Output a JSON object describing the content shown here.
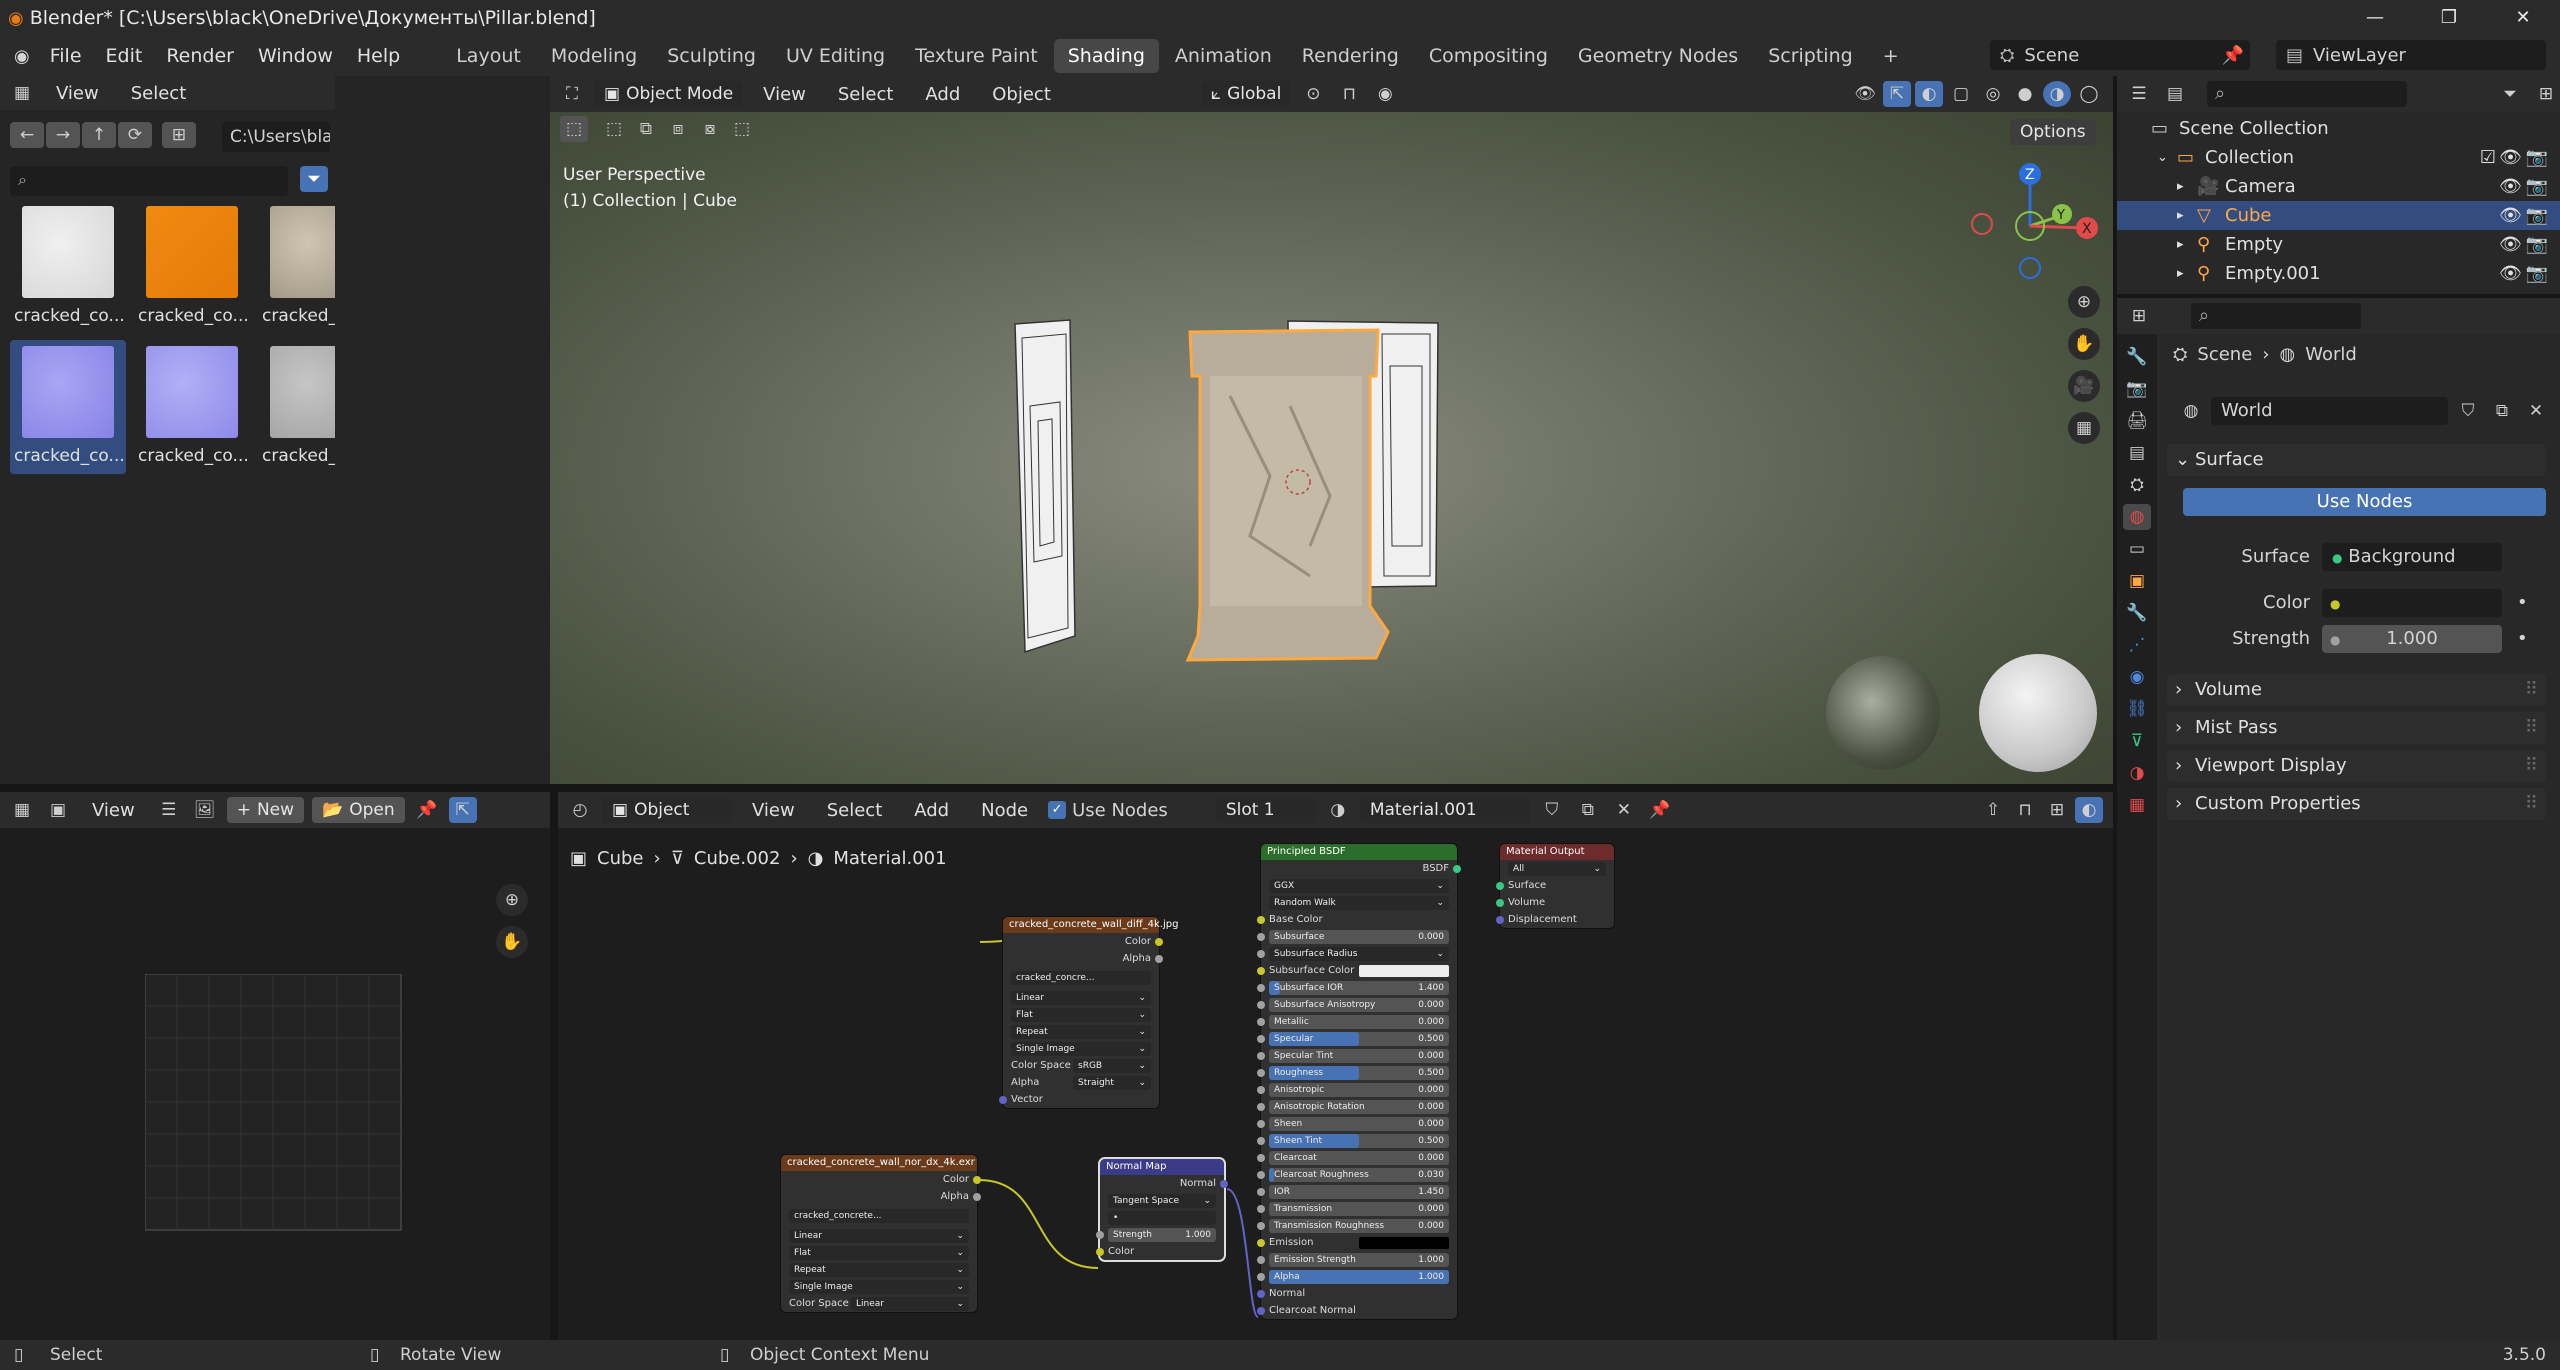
{
  "window": {
    "title": "Blender* [C:\\Users\\black\\OneDrive\\Документы\\Pillar.blend]"
  },
  "menu": [
    "File",
    "Edit",
    "Render",
    "Window",
    "Help"
  ],
  "workspaces": [
    "Layout",
    "Modeling",
    "Sculpting",
    "UV Editing",
    "Texture Paint",
    "Shading",
    "Animation",
    "Rendering",
    "Compositing",
    "Geometry Nodes",
    "Scripting"
  ],
  "active_workspace": "Shading",
  "scene": {
    "label": "Scene",
    "viewlayer": "ViewLayer"
  },
  "filebrowser": {
    "menu": [
      "View",
      "Select"
    ],
    "path": "C:\\Users\\black\\D...concrete\\textures\\",
    "files": [
      {
        "name": "cracked_co...",
        "kind": "white"
      },
      {
        "name": "cracked_co...",
        "kind": "orange"
      },
      {
        "name": "cracked_co...",
        "kind": "diffuse"
      },
      {
        "name": "cracked_co...",
        "kind": "grey"
      },
      {
        "name": "cracked_co...",
        "kind": "normal"
      },
      {
        "name": "cracked_co...",
        "kind": "normal2"
      },
      {
        "name": "cracked_co...",
        "kind": "lightgrey"
      }
    ]
  },
  "viewport": {
    "mode": "Object Mode",
    "menu": [
      "View",
      "Select",
      "Add",
      "Object"
    ],
    "orientation": "Global",
    "options": "Options",
    "info1": "User Perspective",
    "info2": "(1) Collection | Cube"
  },
  "image_editor": {
    "view": "View",
    "new": "New",
    "open": "Open"
  },
  "node_editor": {
    "object": "Object",
    "menu": [
      "View",
      "Select",
      "Add",
      "Node"
    ],
    "use_nodes": "Use Nodes",
    "slot": "Slot 1",
    "material": "Material.001",
    "breadcrumb": [
      "Cube",
      "Cube.002",
      "Material.001"
    ],
    "tex_diff": {
      "title": "cracked_concrete_wall_diff_4k.jpg",
      "outputs": [
        "Color",
        "Alpha"
      ],
      "image": "cracked_concre...",
      "interp": "Linear",
      "proj": "Flat",
      "ext": "Repeat",
      "source": "Single Image",
      "cs_label": "Color Space",
      "cs": "sRGB",
      "alpha_label": "Alpha",
      "alpha": "Straight",
      "vector": "Vector"
    },
    "tex_nor": {
      "title": "cracked_concrete_wall_nor_dx_4k.exr",
      "outputs": [
        "Color",
        "Alpha"
      ],
      "image": "cracked_concrete...",
      "interp": "Linear",
      "proj": "Flat",
      "ext": "Repeat",
      "source": "Single Image",
      "cs_label": "Color Space",
      "cs": "Linear"
    },
    "normal_map": {
      "title": "Normal Map",
      "out": "Normal",
      "space": "Tangent Space",
      "strength_label": "Strength",
      "strength": "1.000",
      "color": "Color"
    },
    "bsdf": {
      "title": "Principled BSDF",
      "out": "BSDF",
      "dist": "GGX",
      "sss": "Random Walk",
      "base": "Base Color",
      "rows": [
        {
          "label": "Subsurface",
          "value": "0.000",
          "fill": 0
        },
        {
          "label": "Subsurface Radius",
          "value": "",
          "fill": 0,
          "dropdown": true
        },
        {
          "label": "Subsurface Color",
          "value": "",
          "fill": 0,
          "color": true
        },
        {
          "label": "Subsurface IOR",
          "value": "1.400",
          "fill": 0.06
        },
        {
          "label": "Subsurface Anisotropy",
          "value": "0.000",
          "fill": 0
        },
        {
          "label": "Metallic",
          "value": "0.000",
          "fill": 0
        },
        {
          "label": "Specular",
          "value": "0.500",
          "fill": 0.5
        },
        {
          "label": "Specular Tint",
          "value": "0.000",
          "fill": 0
        },
        {
          "label": "Roughness",
          "value": "0.500",
          "fill": 0.5
        },
        {
          "label": "Anisotropic",
          "value": "0.000",
          "fill": 0
        },
        {
          "label": "Anisotropic Rotation",
          "value": "0.000",
          "fill": 0
        },
        {
          "label": "Sheen",
          "value": "0.000",
          "fill": 0
        },
        {
          "label": "Sheen Tint",
          "value": "0.500",
          "fill": 0.5
        },
        {
          "label": "Clearcoat",
          "value": "0.000",
          "fill": 0
        },
        {
          "label": "Clearcoat Roughness",
          "value": "0.030",
          "fill": 0.03
        },
        {
          "label": "IOR",
          "value": "1.450",
          "fill": 0
        },
        {
          "label": "Transmission",
          "value": "0.000",
          "fill": 0
        },
        {
          "label": "Transmission Roughness",
          "value": "0.000",
          "fill": 0
        },
        {
          "label": "Emission",
          "value": "",
          "fill": 0,
          "black": true
        },
        {
          "label": "Emission Strength",
          "value": "1.000",
          "fill": 0
        },
        {
          "label": "Alpha",
          "value": "1.000",
          "fill": 1
        },
        {
          "label": "Normal",
          "value": "",
          "fill": 0,
          "plain": true
        },
        {
          "label": "Clearcoat Normal",
          "value": "",
          "fill": 0,
          "plain": true
        }
      ]
    },
    "output": {
      "title": "Material Output",
      "target": "All",
      "inputs": [
        "Surface",
        "Volume",
        "Displacement"
      ]
    }
  },
  "outliner": {
    "root": "Scene Collection",
    "items": [
      {
        "name": "Collection",
        "depth": 1
      },
      {
        "name": "Camera",
        "depth": 2
      },
      {
        "name": "Cube",
        "depth": 2,
        "selected": true
      },
      {
        "name": "Empty",
        "depth": 2
      },
      {
        "name": "Empty.001",
        "depth": 2
      }
    ]
  },
  "properties": {
    "breadcrumb": [
      "Scene",
      "World"
    ],
    "world": "World",
    "surface_panel": "Surface",
    "use_nodes": "Use Nodes",
    "surface_label": "Surface",
    "surface_value": "Background",
    "color_label": "Color",
    "strength_label": "Strength",
    "strength_value": "1.000",
    "panels": [
      "Volume",
      "Mist Pass",
      "Viewport Display",
      "Custom Properties"
    ]
  },
  "status": {
    "select": "Select",
    "rotate": "Rotate View",
    "context": "Object Context Menu",
    "version": "3.5.0"
  },
  "colors": {
    "accent": "#4772b3",
    "selected_text": "#ffa840",
    "header": "#303030",
    "tex_node": "#6b3a1a",
    "vector_node": "#3b3b8a",
    "shader_node": "#2b6e2b",
    "output_node": "#6e2b2b"
  }
}
